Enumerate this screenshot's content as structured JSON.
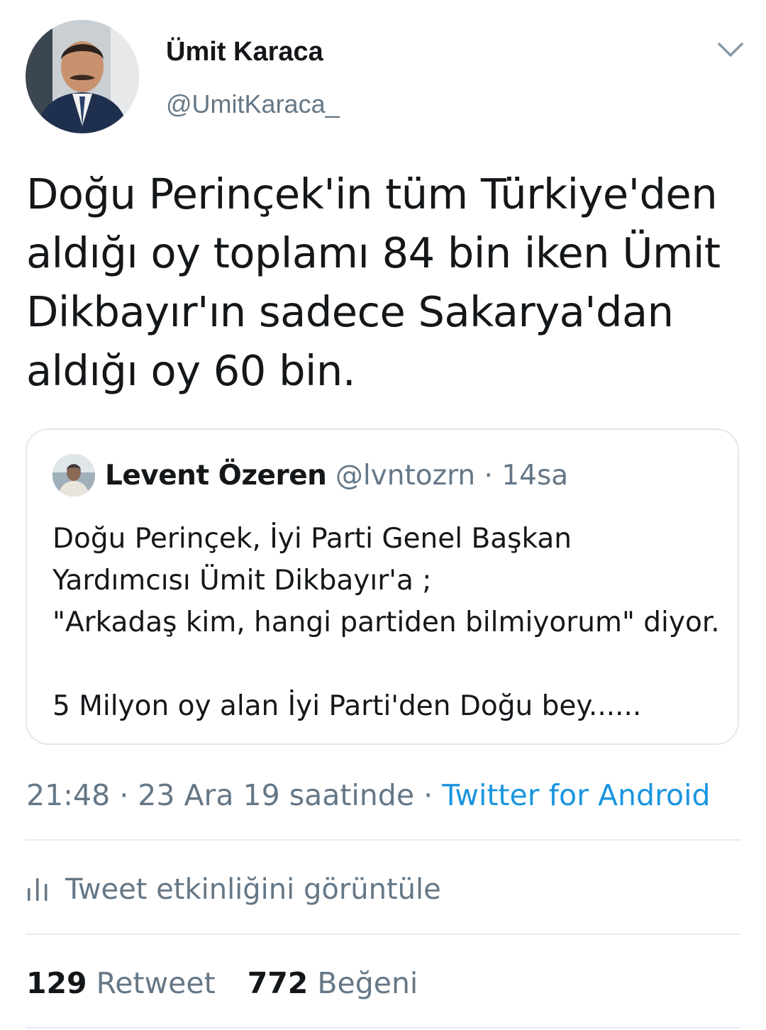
{
  "tweet": {
    "author_name": "Ümit Karaca",
    "author_handle": "@UmitKaraca_",
    "text_lines": [
      "Doğu Perinçek'in tüm Türkiye'den",
      "aldığı oy toplamı 84 bin iken Ümit",
      "Dikbayır'ın sadece Sakarya'dan",
      "aldığı oy 60 bin."
    ],
    "time": "21:48",
    "date": "23 Ara 19 saatinde",
    "separator": " · ",
    "source": "Twitter for Android"
  },
  "quoted_tweet": {
    "author_name": "Levent Özeren",
    "author_handle": "@lvntozrn",
    "age": "14sa",
    "text_lines": [
      "Doğu Perinçek, İyi Parti Genel Başkan",
      "Yardımcısı Ümit Dikbayır'a ;",
      "\"Arkadaş kim, hangi partiden bilmiyorum\" diyor.",
      "",
      "5 Milyon oy alan İyi Parti'den Doğu bey......"
    ]
  },
  "activity": {
    "label": "Tweet etkinliğini görüntüle",
    "icon": "analytics-bars-icon"
  },
  "stats": {
    "retweets_count": "129",
    "retweets_label": "Retweet",
    "likes_count": "772",
    "likes_label": "Beğeni"
  },
  "colors": {
    "text": "#14171a",
    "secondary": "#657786",
    "link": "#1b95e0",
    "border": "#e1e8ed"
  }
}
